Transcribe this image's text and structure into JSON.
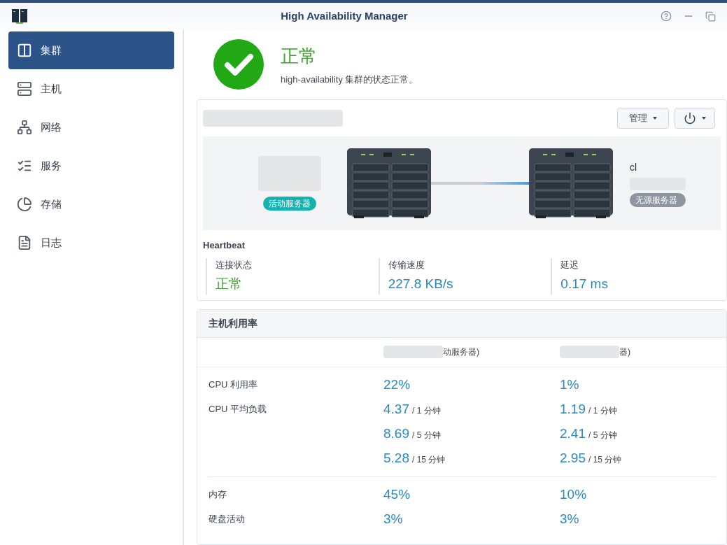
{
  "window": {
    "title": "High Availability Manager"
  },
  "sidebar": {
    "items": [
      {
        "label": "集群",
        "kind": "cluster",
        "selected": true
      },
      {
        "label": "主机",
        "kind": "host",
        "selected": false
      },
      {
        "label": "网络",
        "kind": "network",
        "selected": false
      },
      {
        "label": "服务",
        "kind": "service",
        "selected": false
      },
      {
        "label": "存储",
        "kind": "storage",
        "selected": false
      },
      {
        "label": "日志",
        "kind": "log",
        "selected": false
      }
    ]
  },
  "status": {
    "title": "正常",
    "message": "high-availability 集群的状态正常。"
  },
  "cluster": {
    "manage_button": "管理",
    "active_server": {
      "badge": "活动服务器"
    },
    "passive_server": {
      "name": "cl",
      "badge": "无源服务器"
    }
  },
  "heartbeat": {
    "title": "Heartbeat",
    "metrics": [
      {
        "label": "连接状态",
        "value": "正常",
        "kind": "ok"
      },
      {
        "label": "传输速度",
        "value": "227.8 KB/s",
        "kind": "info"
      },
      {
        "label": "延迟",
        "value": "0.17 ms",
        "kind": "info"
      }
    ]
  },
  "utilization": {
    "title": "主机利用率",
    "columns": [
      "动服务器)",
      "器)"
    ],
    "groups": [
      [
        {
          "label": "CPU 利用率",
          "cells": [
            {
              "value": "22%"
            },
            {
              "value": "1%"
            }
          ]
        },
        {
          "label": "CPU 平均负载",
          "cells": [
            {
              "value": "4.37",
              "unit": "/ 1 分钟"
            },
            {
              "value": "1.19",
              "unit": "/ 1 分钟"
            }
          ]
        },
        {
          "cells": [
            {
              "value": "8.69",
              "unit": "/ 5 分钟"
            },
            {
              "value": "2.41",
              "unit": "/ 5 分钟"
            }
          ]
        },
        {
          "cells": [
            {
              "value": "5.28",
              "unit": "/ 15 分钟"
            },
            {
              "value": "2.95",
              "unit": "/ 15 分钟"
            }
          ]
        }
      ],
      [
        {
          "label": "内存",
          "cells": [
            {
              "value": "45%"
            },
            {
              "value": "10%"
            }
          ]
        },
        {
          "label": "硬盘活动",
          "cells": [
            {
              "value": "3%"
            },
            {
              "value": "3%"
            }
          ]
        }
      ]
    ]
  }
}
